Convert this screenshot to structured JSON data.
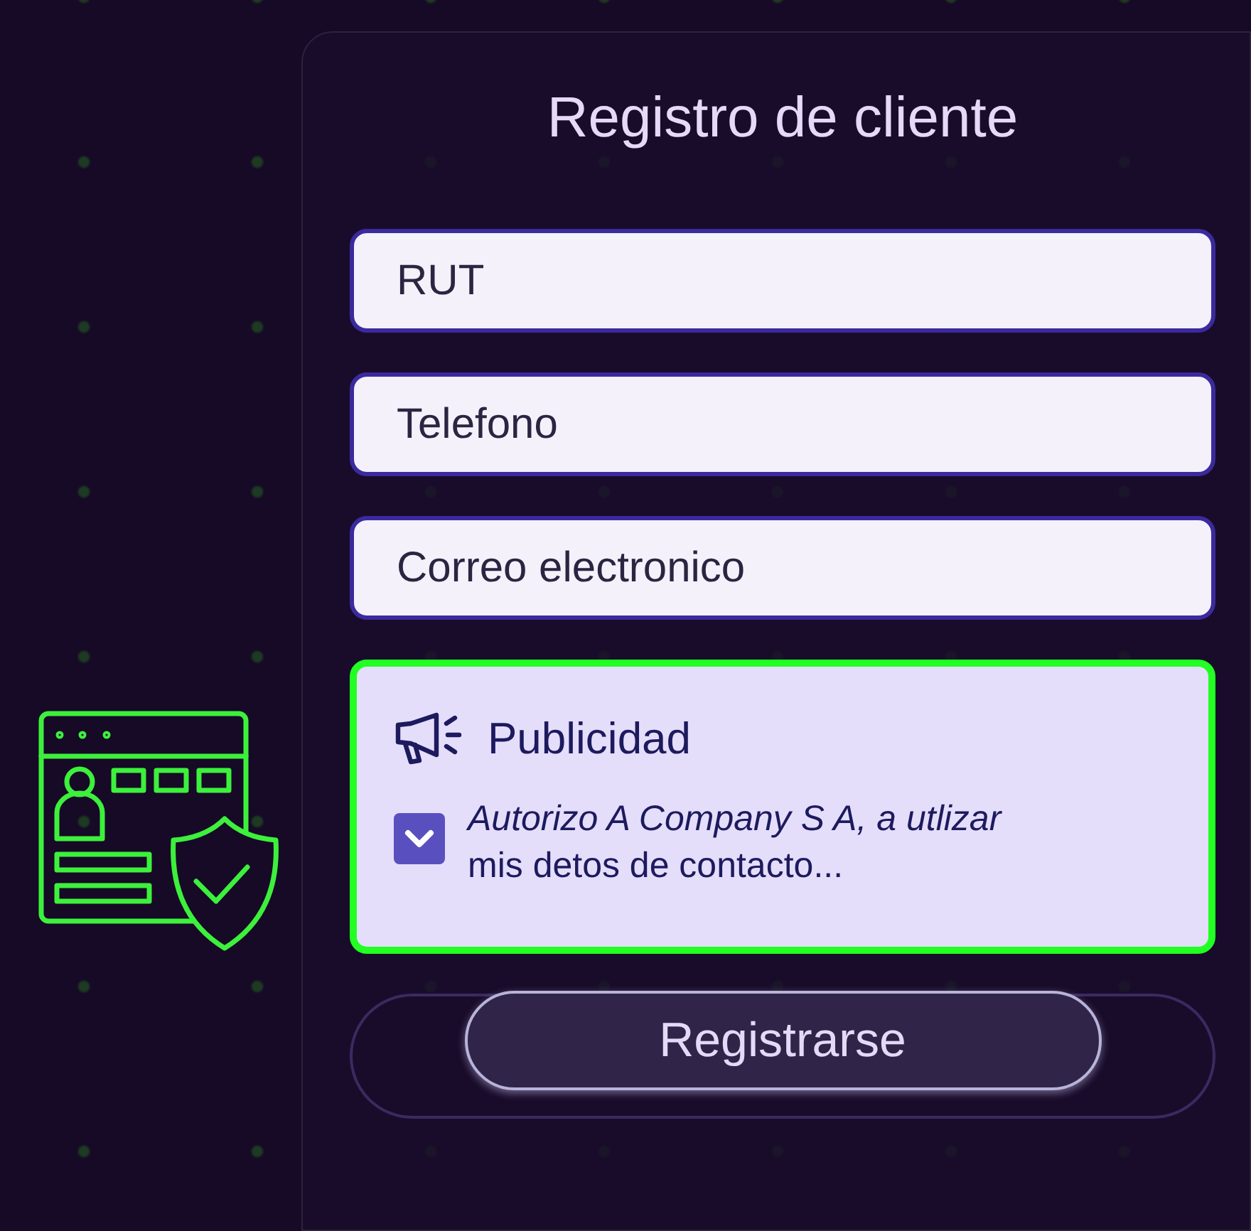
{
  "form": {
    "title": "Registro de cliente",
    "fields": [
      {
        "placeholder": "RUT"
      },
      {
        "placeholder": "Telefono"
      },
      {
        "placeholder": "Correo electronico"
      }
    ],
    "advertising": {
      "title": "Publicidad",
      "consent": {
        "checked": true,
        "text": "Autorizo A Company S A, a utlizar",
        "text_2": "mis detos de contacto..."
      }
    },
    "submit_button": "Registrarse"
  }
}
